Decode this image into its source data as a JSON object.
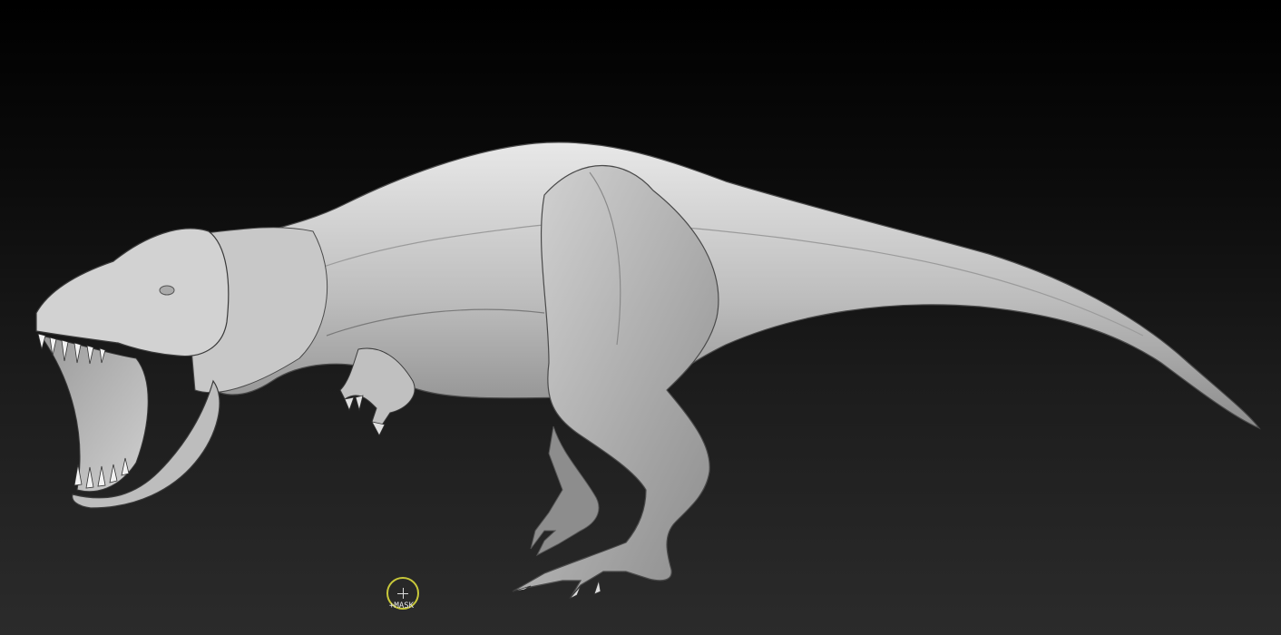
{
  "viewport": {
    "background_top": "#000000",
    "background_bottom": "#2b2b2b",
    "model_color": "#c4c4c4"
  },
  "model": {
    "subject": "trex-sculpt"
  },
  "brush": {
    "mode_label": "+MASK",
    "ring_color": "#c8c83a"
  }
}
